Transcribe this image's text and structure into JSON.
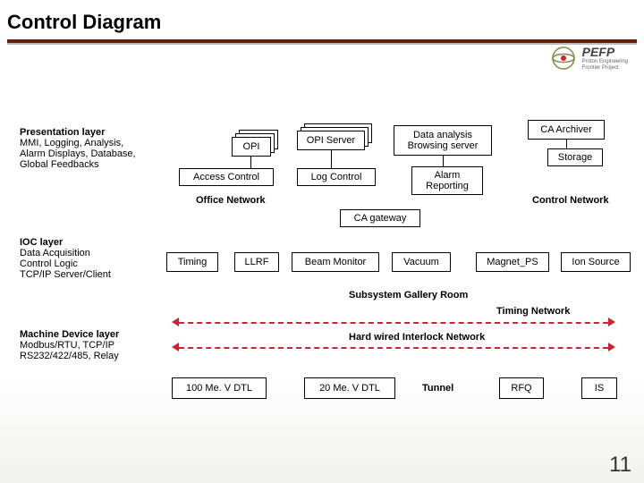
{
  "title": "Control Diagram",
  "logo": {
    "name": "PEFP",
    "subtitle1": "Proton Engineering",
    "subtitle2": "Frontier Project"
  },
  "layers": {
    "presentation": {
      "heading": "Presentation layer",
      "desc": "MMI, Logging, Analysis,\nAlarm Displays, Database,\nGlobal Feedbacks"
    },
    "ioc": {
      "heading": "IOC layer",
      "desc": "Data Acquisition\nControl Logic\nTCP/IP Server/Client"
    },
    "machine": {
      "heading": "Machine Device layer",
      "desc": "Modbus/RTU, TCP/IP\nRS232/422/485, Relay"
    }
  },
  "boxes": {
    "opi": "OPI",
    "opi_server": "OPI Server",
    "data_analysis": "Data analysis\nBrowsing server",
    "ca_archiver": "CA Archiver",
    "storage": "Storage",
    "access_control": "Access Control",
    "log_control": "Log Control",
    "alarm_reporting": "Alarm\nReporting",
    "office_network": "Office Network",
    "control_network": "Control Network",
    "ca_gateway": "CA gateway",
    "timing": "Timing",
    "llrf": "LLRF",
    "beam_monitor": "Beam Monitor",
    "vacuum": "Vacuum",
    "magnet_ps": "Magnet_PS",
    "ion_source": "Ion Source",
    "subsystem_room": "Subsystem Gallery Room",
    "timing_network": "Timing Network",
    "interlock_network": "Hard wired Interlock Network",
    "dtl100": "100 Me. V DTL",
    "dtl20": "20 Me. V DTL",
    "tunnel": "Tunnel",
    "rfq": "RFQ",
    "is": "IS"
  },
  "page_number": "11"
}
